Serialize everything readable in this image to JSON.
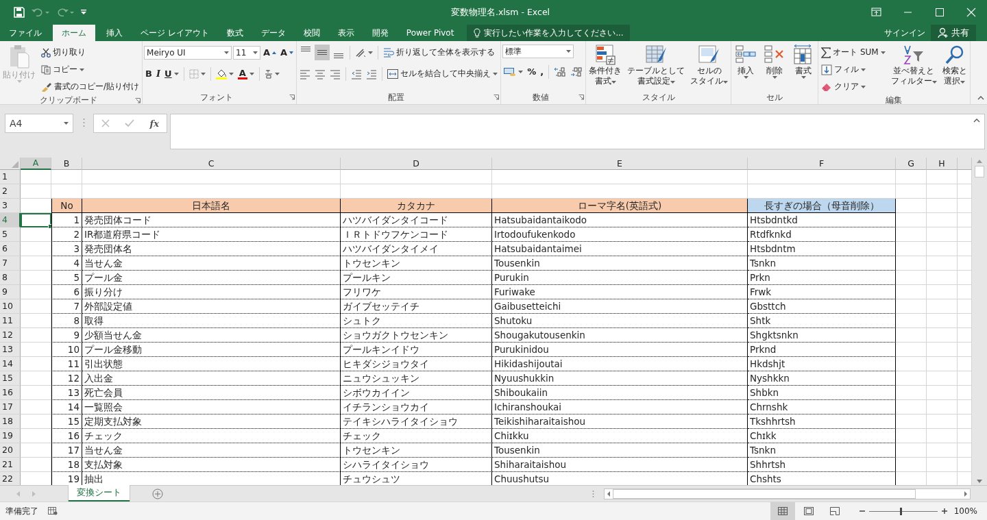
{
  "title_bar": {
    "title": "変数物理名.xlsm - Excel",
    "undo": {
      "disabled": true
    },
    "redo": {
      "disabled": true
    }
  },
  "menu_tabs": [
    {
      "label": "ファイル",
      "selected": false
    },
    {
      "label": "ホーム",
      "selected": true
    },
    {
      "label": "挿入",
      "selected": false
    },
    {
      "label": "ページ レイアウト",
      "selected": false
    },
    {
      "label": "数式",
      "selected": false
    },
    {
      "label": "データ",
      "selected": false
    },
    {
      "label": "校閲",
      "selected": false
    },
    {
      "label": "表示",
      "selected": false
    },
    {
      "label": "開発",
      "selected": false
    },
    {
      "label": "Power Pivot",
      "selected": false
    }
  ],
  "tell_me": {
    "placeholder": "実行したい作業を入力してください..."
  },
  "sign_in": "サインイン",
  "share": "共有",
  "ribbon": {
    "clipboard": {
      "label": "クリップボード",
      "paste": {
        "label": "貼り付け",
        "disabled": true
      },
      "cut": "切り取り",
      "copy": "コピー",
      "format_painter": "書式のコピー/貼り付け"
    },
    "font": {
      "label": "フォント",
      "font_name": "Meiryo UI",
      "font_size": "11",
      "grow": "A",
      "shrink": "A",
      "bold": "B",
      "italic": "I",
      "underline": "U",
      "font_color": "A"
    },
    "alignment": {
      "label": "配置",
      "vertical": [
        {
          "selected": false
        },
        {
          "selected": true
        },
        {
          "selected": false
        }
      ],
      "wrap": "折り返して全体を表示する",
      "merge": "セルを結合して中央揃え"
    },
    "number": {
      "label": "数値",
      "format": "標準",
      "percent": "%",
      "comma": ","
    },
    "styles": {
      "label": "スタイル",
      "buttons": [
        [
          "条件付き",
          "書式"
        ],
        [
          "テーブルとして",
          "書式設定"
        ],
        [
          "セルの",
          "スタイル"
        ]
      ]
    },
    "cells": {
      "label": "セル",
      "buttons": [
        "挿入",
        "削除",
        "書式"
      ]
    },
    "editing": {
      "label": "編集",
      "autosum": "オート SUM",
      "fill": "フィル",
      "clear": "クリア",
      "sort": [
        "並べ替えと",
        "フィルター"
      ],
      "find": [
        "検索と",
        "選択"
      ]
    }
  },
  "formula_bar": {
    "name_box": "A4",
    "function_label": "fx"
  },
  "columns": [
    {
      "label": "A",
      "selected": true
    },
    {
      "label": "B",
      "selected": false
    },
    {
      "label": "C",
      "selected": false
    },
    {
      "label": "D",
      "selected": false
    },
    {
      "label": "E",
      "selected": false
    },
    {
      "label": "F",
      "selected": false
    },
    {
      "label": "G",
      "selected": false
    },
    {
      "label": "H",
      "selected": false
    }
  ],
  "rows": [
    {
      "number": "1",
      "selected": false
    },
    {
      "number": "2",
      "selected": false
    },
    {
      "number": "3",
      "selected": false
    },
    {
      "number": "4",
      "selected": true
    },
    {
      "number": "5",
      "selected": false
    },
    {
      "number": "6",
      "selected": false
    },
    {
      "number": "7",
      "selected": false
    },
    {
      "number": "8",
      "selected": false
    },
    {
      "number": "9",
      "selected": false
    },
    {
      "number": "10",
      "selected": false
    },
    {
      "number": "11",
      "selected": false
    },
    {
      "number": "12",
      "selected": false
    },
    {
      "number": "13",
      "selected": false
    },
    {
      "number": "14",
      "selected": false
    },
    {
      "number": "15",
      "selected": false
    },
    {
      "number": "16",
      "selected": false
    },
    {
      "number": "17",
      "selected": false
    },
    {
      "number": "18",
      "selected": false
    },
    {
      "number": "19",
      "selected": false
    },
    {
      "number": "20",
      "selected": false
    },
    {
      "number": "21",
      "selected": false
    },
    {
      "number": "22",
      "selected": false
    }
  ],
  "table": {
    "header": [
      {
        "label": "No",
        "color": "#f8cbad"
      },
      {
        "label": "日本語名",
        "color": "#f8cbad"
      },
      {
        "label": "カタカナ",
        "color": "#f8cbad"
      },
      {
        "label": "ローマ字名(英語式)",
        "color": "#f8cbad"
      },
      {
        "label": "長すぎの場合（母音削除）",
        "color": "#bdd7ee"
      }
    ],
    "rows": [
      [
        "1",
        "発売団体コード",
        "ハツバイダンタイコード",
        "Hatsubaidantaikodo",
        "Htsbdntkd"
      ],
      [
        "2",
        "IR都道府県コード",
        "ＩＲトドウフケンコード",
        "Irtodoufukenkodo",
        "Rtdfknkd"
      ],
      [
        "3",
        "発売団体名",
        "ハツバイダンタイメイ",
        "Hatsubaidantaimei",
        "Htsbdntm"
      ],
      [
        "4",
        "当せん金",
        "トウセンキン",
        "Tousenkin",
        "Tsnkn"
      ],
      [
        "5",
        "プール金",
        "プールキン",
        "Purukin",
        "Prkn"
      ],
      [
        "6",
        "振り分け",
        "フリワケ",
        "Furiwake",
        "Frwk"
      ],
      [
        "7",
        "外部設定値",
        "ガイブセッテイチ",
        "Gaibusetteichi",
        "Gbsttch"
      ],
      [
        "8",
        "取得",
        "シュトク",
        "Shutoku",
        "Shtk"
      ],
      [
        "9",
        "少額当せん金",
        "ショウガクトウセンキン",
        "Shougakutousenkin",
        "Shgktsnkn"
      ],
      [
        "10",
        "プール金移動",
        "プールキンイドウ",
        "Purukinidou",
        "Prknd"
      ],
      [
        "11",
        "引出状態",
        "ヒキダシジョウタイ",
        "Hikidashijoutai",
        "Hkdshjt"
      ],
      [
        "12",
        "入出金",
        "ニュウシュッキン",
        "Nyuushukkin",
        "Nyshkkn"
      ],
      [
        "13",
        "死亡会員",
        "シボウカイイン",
        "Shiboukaiin",
        "Shbkn"
      ],
      [
        "14",
        "一覧照会",
        "イチランショウカイ",
        "Ichiranshoukai",
        "Chrnshk"
      ],
      [
        "15",
        "定期支払対象",
        "テイキシハライタイショウ",
        "Teikishiharaitaishou",
        "Tkshhrtsh"
      ],
      [
        "16",
        "チェック",
        "チェック",
        "Chiɪkku",
        "Chɪkk"
      ],
      [
        "17",
        "当せん金",
        "トウセンキン",
        "Tousenkin",
        "Tsnkn"
      ],
      [
        "18",
        "支払対象",
        "シハライタイショウ",
        "Shiharaitaishou",
        "Shhrtsh"
      ],
      [
        "19",
        "抽出",
        "チュウシュツ",
        "Chuushutsu",
        "Chshts"
      ]
    ]
  },
  "sheet_tabs": [
    {
      "label": "変換シート",
      "selected": true
    }
  ],
  "status_bar": {
    "status": "準備完了",
    "views": [
      {
        "selected": true
      },
      {
        "selected": false
      },
      {
        "selected": false
      }
    ],
    "zoom": {
      "level": 0.47,
      "label": "100%"
    }
  }
}
